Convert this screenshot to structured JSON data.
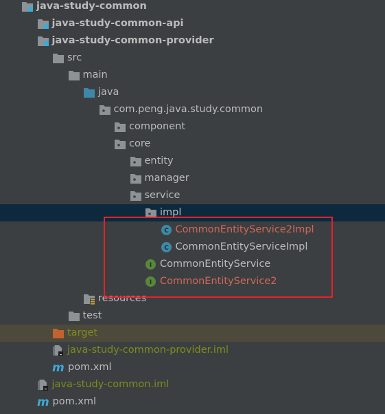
{
  "colors": {
    "background": "#3c3f41",
    "selected_row": "#0d293e",
    "excluded_row": "#4d4a3c",
    "text_default": "#bbbbbb",
    "text_new_file": "#d1675a",
    "text_ignored": "#7d8c1d",
    "highlight_box": "#e8202a",
    "module_badge": "#3fa9d8",
    "class_icon": "#3d8aa8",
    "interface_icon": "#59873a",
    "source_folder": "#3d87a8",
    "excluded_folder": "#c1622f",
    "maven_icon": "#3fa9d8"
  },
  "tree": [
    {
      "label": "java-study-common",
      "level": 0,
      "expanded": true,
      "icon": "module-folder-icon",
      "bold": true,
      "color": "default"
    },
    {
      "label": "java-study-common-api",
      "level": 1,
      "expanded": false,
      "icon": "module-folder-icon",
      "bold": true,
      "color": "default"
    },
    {
      "label": "java-study-common-provider",
      "level": 1,
      "expanded": true,
      "icon": "module-folder-icon",
      "bold": true,
      "color": "default"
    },
    {
      "label": "src",
      "level": 2,
      "expanded": true,
      "icon": "folder-icon",
      "color": "default"
    },
    {
      "label": "main",
      "level": 3,
      "expanded": true,
      "icon": "folder-icon",
      "color": "default"
    },
    {
      "label": "java",
      "level": 4,
      "expanded": true,
      "icon": "source-folder-icon",
      "color": "default"
    },
    {
      "label": "com.peng.java.study.common",
      "level": 5,
      "expanded": true,
      "icon": "package-icon",
      "color": "default"
    },
    {
      "label": "component",
      "level": 6,
      "icon": "package-icon",
      "color": "default"
    },
    {
      "label": "core",
      "level": 6,
      "expanded": true,
      "icon": "package-icon",
      "color": "default"
    },
    {
      "label": "entity",
      "level": 7,
      "expanded": false,
      "icon": "package-icon",
      "color": "default"
    },
    {
      "label": "manager",
      "level": 7,
      "expanded": false,
      "icon": "package-icon",
      "color": "default"
    },
    {
      "label": "service",
      "level": 7,
      "expanded": true,
      "icon": "package-icon",
      "color": "default"
    },
    {
      "label": "impl",
      "level": 8,
      "expanded": true,
      "icon": "package-icon",
      "color": "default",
      "selected": true
    },
    {
      "label": "CommonEntityService2Impl",
      "level": 9,
      "icon": "class-icon",
      "icon_letter": "C",
      "color": "red"
    },
    {
      "label": "CommonEntityServiceImpl",
      "level": 9,
      "icon": "class-icon",
      "icon_letter": "C",
      "color": "default"
    },
    {
      "label": "CommonEntityService",
      "level": 8,
      "icon": "interface-icon",
      "icon_letter": "I",
      "color": "default"
    },
    {
      "label": "CommonEntityService2",
      "level": 8,
      "icon": "interface-icon",
      "icon_letter": "I",
      "color": "red"
    },
    {
      "label": "resources",
      "level": 4,
      "expanded": false,
      "icon": "resources-folder-icon",
      "color": "default"
    },
    {
      "label": "test",
      "level": 3,
      "expanded": false,
      "icon": "folder-icon",
      "color": "default"
    },
    {
      "label": "target",
      "level": 2,
      "expanded": false,
      "icon": "excluded-folder-icon",
      "color": "olive",
      "excluded": true
    },
    {
      "label": "java-study-common-provider.iml",
      "level": 2,
      "icon": "iml-file-icon",
      "color": "olive"
    },
    {
      "label": "pom.xml",
      "level": 2,
      "icon": "maven-icon",
      "icon_letter": "m",
      "color": "default"
    },
    {
      "label": "java-study-common.iml",
      "level": 1,
      "icon": "iml-file-icon",
      "color": "olive"
    },
    {
      "label": "pom.xml",
      "level": 1,
      "icon": "maven-icon",
      "icon_letter": "m",
      "color": "default"
    }
  ]
}
